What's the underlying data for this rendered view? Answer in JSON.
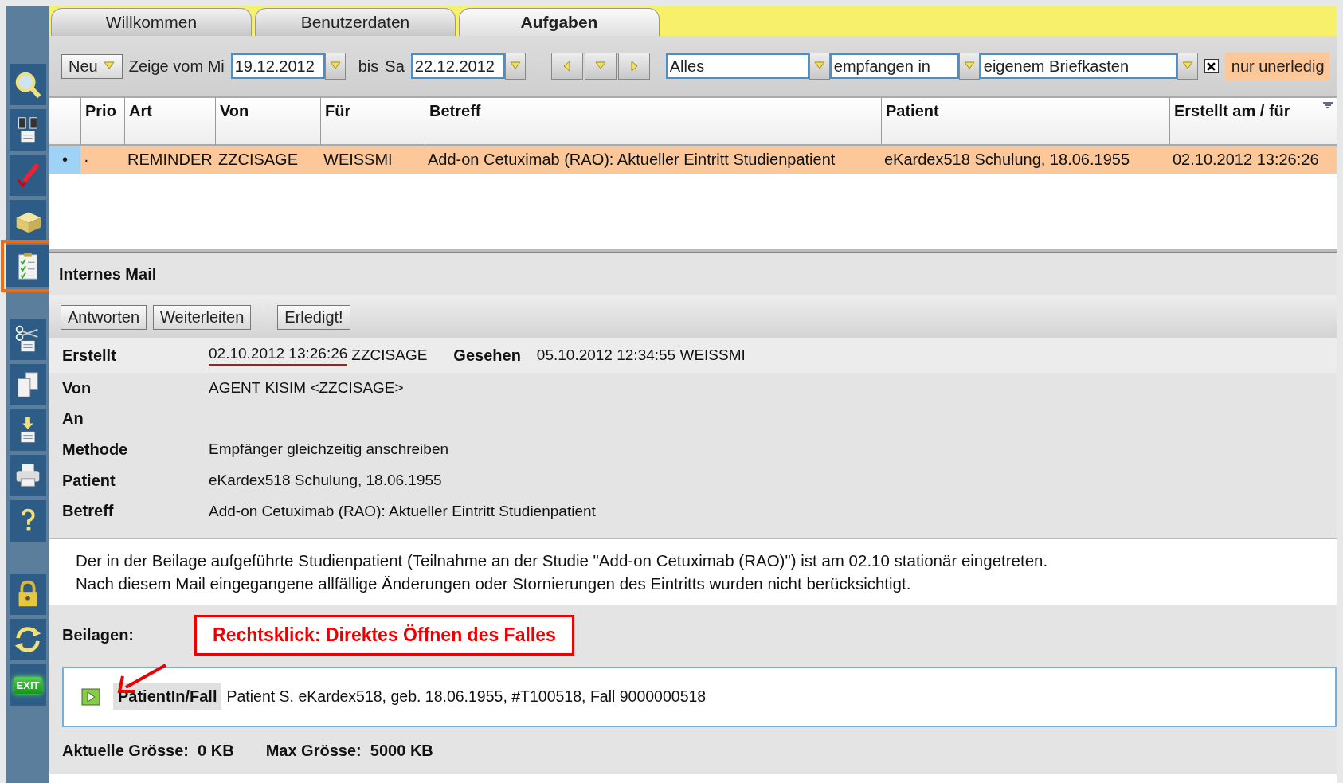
{
  "sidebar": {
    "items": [
      {
        "kind": "search",
        "selected": false
      },
      {
        "kind": "binoculars",
        "selected": false
      },
      {
        "kind": "pencil",
        "selected": false
      },
      {
        "kind": "brick",
        "selected": false
      },
      {
        "kind": "clipboard",
        "selected": true
      },
      {
        "kind": "gap"
      },
      {
        "kind": "scissors",
        "selected": false
      },
      {
        "kind": "copy",
        "selected": false
      },
      {
        "kind": "download",
        "selected": false
      },
      {
        "kind": "printer",
        "selected": false
      },
      {
        "kind": "help",
        "selected": false
      },
      {
        "kind": "gap"
      },
      {
        "kind": "lock",
        "selected": false
      },
      {
        "kind": "refresh",
        "selected": false
      },
      {
        "kind": "exit",
        "selected": false,
        "label": "EXIT"
      }
    ]
  },
  "tabs": [
    {
      "label": "Willkommen",
      "selected": false
    },
    {
      "label": "Benutzerdaten",
      "selected": false
    },
    {
      "label": "Aufgaben",
      "selected": true
    }
  ],
  "toolbar": {
    "new_button": "Neu",
    "range_label": "Zeige vom Mi",
    "from_date": "19.12.2012",
    "until_label": "bis",
    "until_day": "Sa",
    "to_date": "22.12.2012",
    "filters": [
      {
        "value": "Alles"
      },
      {
        "value": "empfangen in"
      },
      {
        "value": "eigenem Briefkasten"
      }
    ],
    "only_open": {
      "label": "nur unerledig",
      "checked": true
    }
  },
  "table": {
    "columns": [
      "Prio",
      "Art",
      "Von",
      "Für",
      "Betreff",
      "Patient",
      "Erstellt am / für"
    ],
    "rows": [
      {
        "selected": true,
        "marker": "•",
        "cells": [
          "·",
          "REMINDER",
          "ZZCISAGE",
          "WEISSMI",
          "Add-on Cetuximab (RAO): Aktueller Eintritt Studienpatient",
          "eKardex518 Schulung, 18.06.1955",
          "02.10.2012 13:26:26"
        ]
      }
    ]
  },
  "mail": {
    "title": "Internes Mail",
    "button_groups": [
      [
        "Antworten",
        "Weiterleiten"
      ],
      [
        "Erledigt!"
      ]
    ],
    "created": {
      "label": "Erstellt",
      "date": "02.10.2012 13:26:26",
      "underlined": true,
      "user": "ZZCISAGE",
      "seen_label": "Gesehen",
      "seen_value": "05.10.2012 12:34:55 WEISSMI"
    },
    "fields": [
      {
        "label": "Von",
        "value": "AGENT KISIM <ZZCISAGE>"
      },
      {
        "label": "An"
      },
      {
        "label": "Methode",
        "value": "Empfänger gleichzeitig anschreiben"
      },
      {
        "label": "Patient",
        "value": "eKardex518 Schulung, 18.06.1955"
      },
      {
        "label": "Betreff",
        "value": "Add-on Cetuximab (RAO): Aktueller Eintritt Studienpatient"
      }
    ],
    "body": [
      "Der in der Beilage aufgeführte Studienpatient (Teilnahme an der Studie \"Add-on Cetuximab (RAO)\") ist am 02.10 stationär eingetreten.",
      "Nach diesem Mail eingegangene allfällige Änderungen oder Stornierungen des Eintritts wurden nicht berücksichtigt."
    ],
    "attachments_label": "Beilagen:",
    "callout": "Rechtsklick: Direktes Öffnen des Falles",
    "attachments": [
      {
        "type": "PatientIn/Fall",
        "description": "Patient S. eKardex518, geb. 18.06.1955, #T100518, Fall 9000000518"
      }
    ],
    "sizes": [
      {
        "label": "Aktuelle Grösse:",
        "value": "0 KB"
      },
      {
        "label": "Max Grösse:",
        "value": "5000 KB"
      }
    ]
  }
}
